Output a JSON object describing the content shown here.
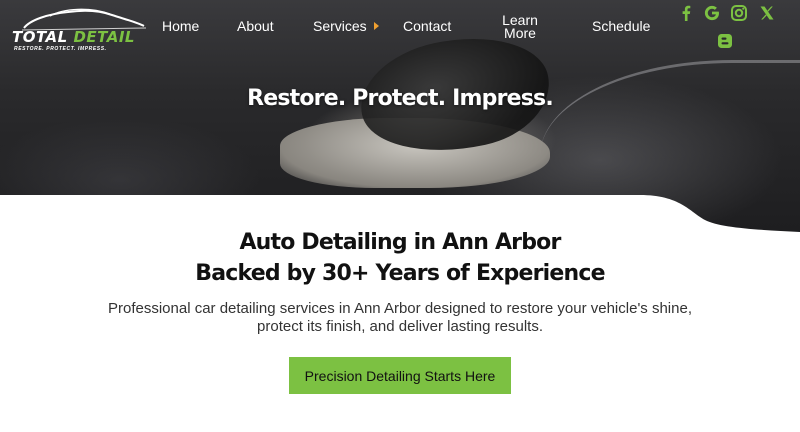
{
  "brand": {
    "logo_word1": "TOTAL",
    "logo_word2": "DETAIL",
    "tagline": "RESTORE. PROTECT. IMPRESS.",
    "accent_color": "#7cc142"
  },
  "nav": {
    "home": "Home",
    "about": "About",
    "services": "Services",
    "contact": "Contact",
    "learn_more_line1": "Learn",
    "learn_more_line2": "More",
    "schedule": "Schedule"
  },
  "social": {
    "icons": [
      "facebook-icon",
      "google-icon",
      "instagram-icon",
      "x-icon",
      "blogger-icon"
    ]
  },
  "hero": {
    "title": "Restore. Protect. Impress."
  },
  "main": {
    "heading_line1": "Auto Detailing in Ann Arbor",
    "heading_line2": "Backed by 30+ Years of Experience",
    "description_line1": "Professional car detailing services in Ann Arbor designed to restore your vehicle's shine,",
    "description_line2": "protect its finish, and deliver lasting results.",
    "cta_label": "Precision Detailing Starts Here"
  }
}
